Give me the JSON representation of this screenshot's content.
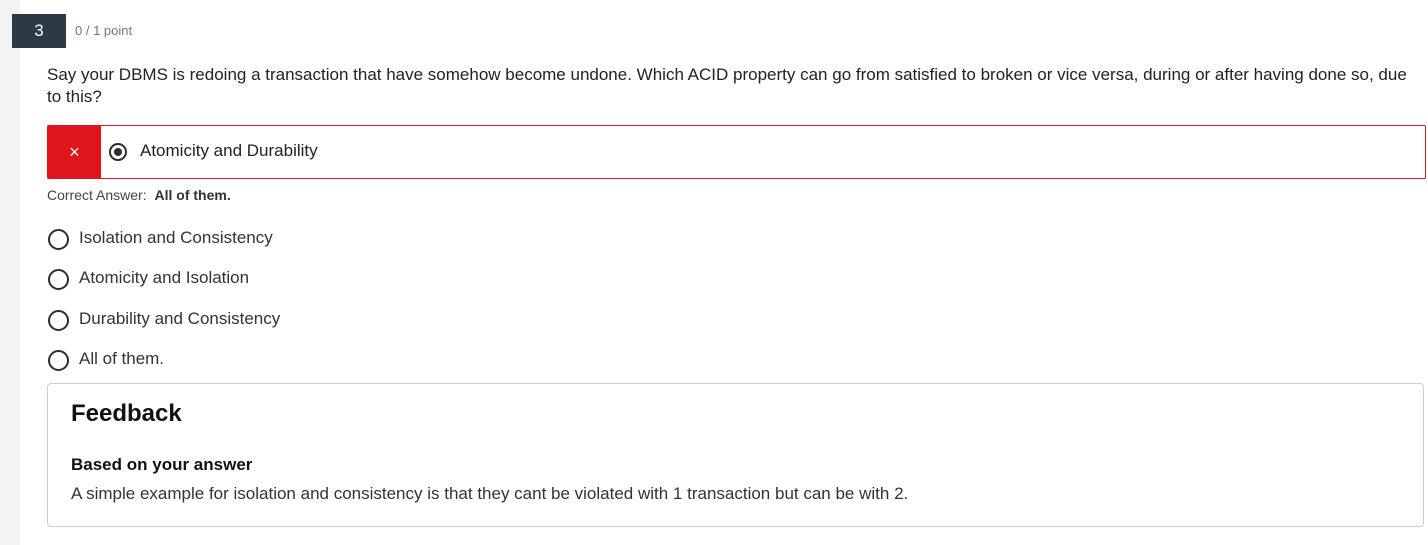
{
  "question": {
    "number": "3",
    "points": "0 / 1 point",
    "text": "Say your DBMS is redoing a transaction that have somehow become undone. Which ACID property can go from satisfied to broken or vice versa, during or after having done so, due to this?"
  },
  "selected_answer": {
    "status_icon": "×",
    "label": "Atomicity and Durability",
    "status": "incorrect"
  },
  "correct_answer": {
    "prefix": "Correct Answer:",
    "value": "All of them."
  },
  "options": [
    {
      "label": "Isolation and Consistency"
    },
    {
      "label": "Atomicity and Isolation"
    },
    {
      "label": "Durability and Consistency"
    },
    {
      "label": "All of them."
    }
  ],
  "feedback": {
    "title": "Feedback",
    "subtitle": "Based on your answer",
    "text": "A simple example for isolation and consistency is that they cant be violated with 1 transaction but can be with 2."
  },
  "colors": {
    "incorrect": "#e0151b",
    "question_badge": "#2d3a44"
  }
}
